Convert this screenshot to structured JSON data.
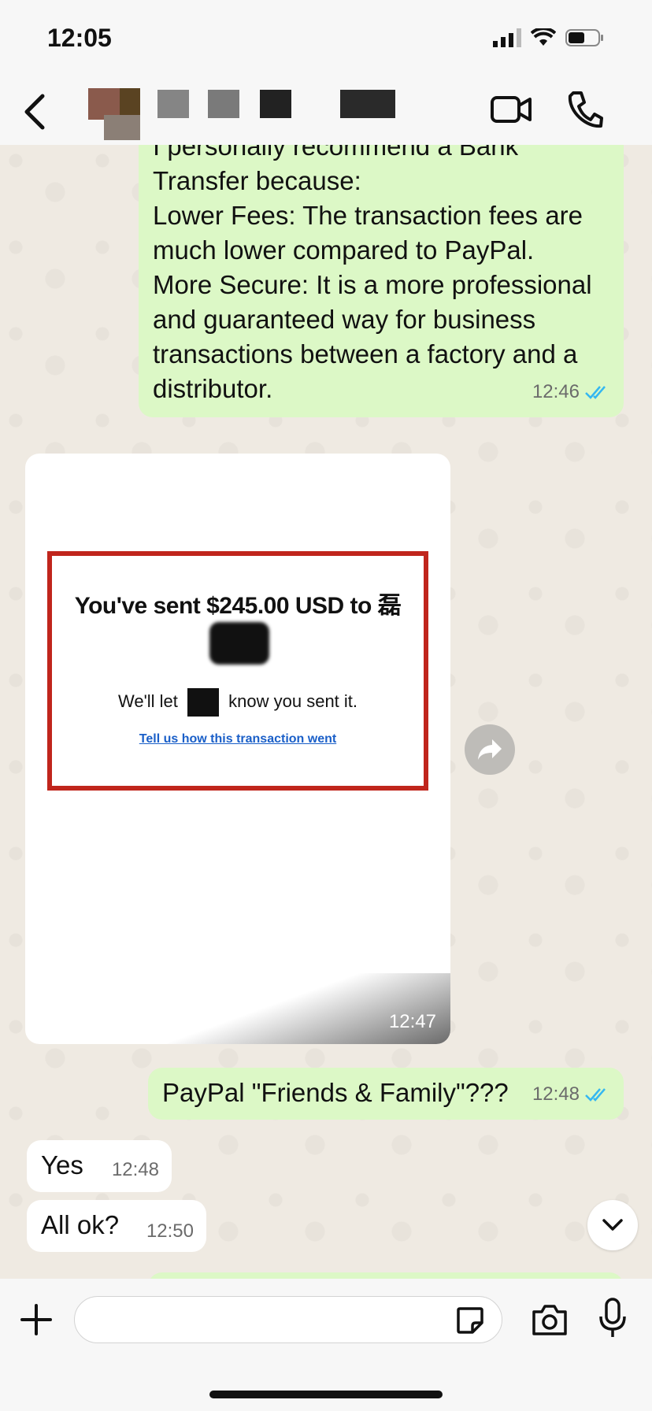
{
  "status": {
    "time": "12:05"
  },
  "header": {
    "back_icon": "chevron-left-icon",
    "contact_name_redacted": true,
    "video_icon": "video-camera-icon",
    "call_icon": "phone-icon"
  },
  "messages": [
    {
      "direction": "outgoing",
      "lines": [
        "I personally recommend a Bank",
        "Transfer because:",
        "Lower Fees: The transaction fees are",
        "much lower compared to PayPal.",
        "More Secure: It is a more professional",
        "and guaranteed way for business",
        "transactions between a factory and a",
        "distributor."
      ],
      "time": "12:46",
      "status": "read"
    },
    {
      "direction": "incoming",
      "type": "image",
      "image": {
        "title": "You've sent $245.00 USD to 磊",
        "subtitle_pre": "We'll let",
        "subtitle_post": "know you sent it.",
        "link": "Tell us how this transaction went"
      },
      "time": "12:47"
    },
    {
      "direction": "outgoing",
      "text": "PayPal \"Friends & Family\"???",
      "time": "12:48",
      "status": "read"
    },
    {
      "direction": "incoming",
      "text": "Yes",
      "time": "12:48"
    },
    {
      "direction": "incoming",
      "text": "All ok?",
      "time": "12:50"
    }
  ],
  "composer": {
    "plus_icon": "plus-icon",
    "sticker_icon": "sticker-icon",
    "camera_icon": "camera-icon",
    "mic_icon": "microphone-icon",
    "input_value": ""
  },
  "colors": {
    "outgoing": "#dcf8c6",
    "incoming": "#ffffff",
    "read_ticks": "#34b7f1",
    "link": "#1a5fc8",
    "frame": "#c0251c"
  }
}
